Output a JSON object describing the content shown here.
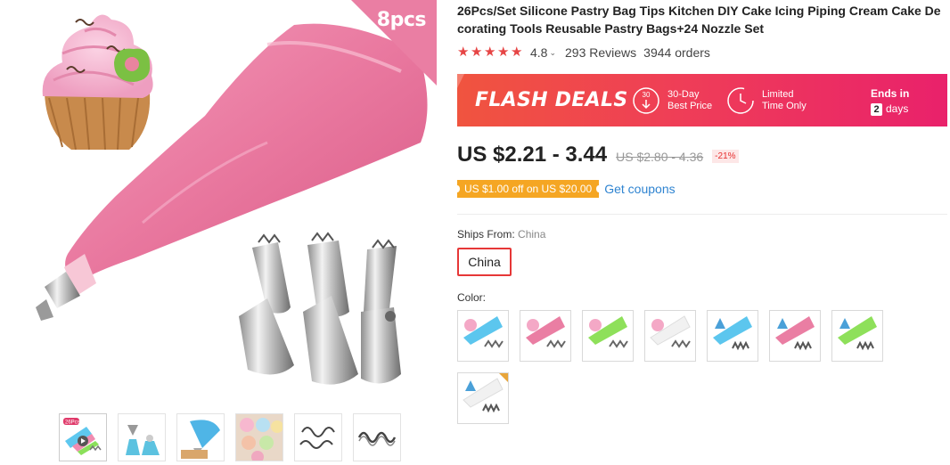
{
  "product": {
    "title": "26Pcs/Set Silicone Pastry Bag Tips Kitchen DIY Cake Icing Piping Cream Cake Decorating Tools Reusable Pastry Bags+24 Nozzle Set",
    "badge_text": "8pcs",
    "rating": {
      "stars": 5,
      "value": "4.8",
      "caret": "⌄",
      "reviews": "293 Reviews",
      "orders": "3944 orders"
    },
    "price": "US $2.21 - 3.44",
    "old_price": "US $2.80 - 4.36",
    "discount": "-21%",
    "coupon": "US $1.00 off on US $20.00",
    "get_coupons": "Get coupons"
  },
  "flash_deals": {
    "title": "FLASH DEALS",
    "feature1_icon_text": "30",
    "feature1_line1": "30-Day",
    "feature1_line2": "Best Price",
    "feature2_line1": "Limited",
    "feature2_line2": "Time Only",
    "ends_label": "Ends in",
    "ends_value": "2",
    "ends_unit": "days"
  },
  "shipping": {
    "label": "Ships From:",
    "selected": "China",
    "option": "China"
  },
  "color": {
    "label": "Color:",
    "swatch_count": 8
  },
  "gallery": {
    "thumbnail_badge": "26Pcs",
    "thumbnail_count": 6
  },
  "colors": {
    "flash_start": "#f0543f",
    "flash_end": "#e9216b",
    "star": "#e64545",
    "coupon": "#f5a623",
    "link": "#2f84d1",
    "selected_border": "#e63737",
    "bag_pink": "#ea7ea3"
  }
}
